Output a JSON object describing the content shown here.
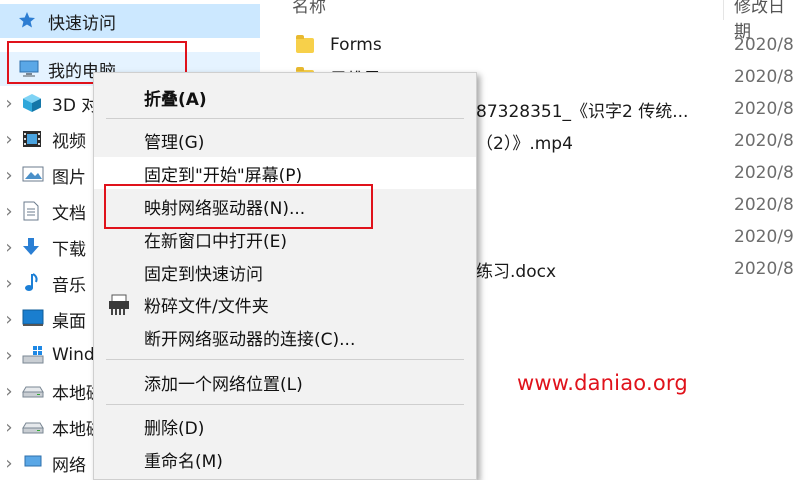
{
  "nav": {
    "quick_access": "快速访问",
    "this_pc": "我的电脑",
    "items": [
      {
        "label": "3D 对",
        "icon": "3d-objects-icon"
      },
      {
        "label": "视频",
        "icon": "videos-icon"
      },
      {
        "label": "图片",
        "icon": "pictures-icon"
      },
      {
        "label": "文档",
        "icon": "documents-icon"
      },
      {
        "label": "下载",
        "icon": "downloads-icon"
      },
      {
        "label": "音乐",
        "icon": "music-icon"
      },
      {
        "label": "桌面",
        "icon": "desktop-icon"
      },
      {
        "label": "Wind",
        "icon": "windows-drive-icon"
      },
      {
        "label": "本地磁",
        "icon": "local-disk-icon"
      },
      {
        "label": "本地磁",
        "icon": "local-disk-icon"
      },
      {
        "label": "网络",
        "icon": "network-icon"
      }
    ]
  },
  "files": {
    "col_name": "名称",
    "col_date": "修改日期",
    "rows": [
      {
        "name": "Forms",
        "date": "2020/8"
      },
      {
        "name": "思维导",
        "date": "2020/8"
      },
      {
        "name": "87328351_《识字2  传统...",
        "date": "2020/8"
      },
      {
        "name": "（2）》.mp4",
        "date": "2020/8"
      },
      {
        "name": "",
        "date": "2020/8"
      },
      {
        "name": "",
        "date": "2020/8"
      },
      {
        "name": "",
        "date": "2020/9"
      },
      {
        "name": "练习.docx",
        "date": "2020/8"
      }
    ]
  },
  "menu": {
    "collapse": "折叠(A)",
    "manage": "管理(G)",
    "pin_start": "固定到\"开始\"屏幕(P)",
    "map_drive": "映射网络驱动器(N)...",
    "open_new_window": "在新窗口中打开(E)",
    "pin_quick": "固定到快速访问",
    "shred": "粉碎文件/文件夹",
    "disconnect": "断开网络驱动器的连接(C)...",
    "add_location": "添加一个网络位置(L)",
    "delete": "删除(D)",
    "rename": "重命名(M)"
  },
  "watermark": "www.daniao.org",
  "colors": {
    "highlight_red": "#e0121b",
    "nav_selected": "#cce8ff",
    "menu_bg": "#f2f2f2"
  }
}
